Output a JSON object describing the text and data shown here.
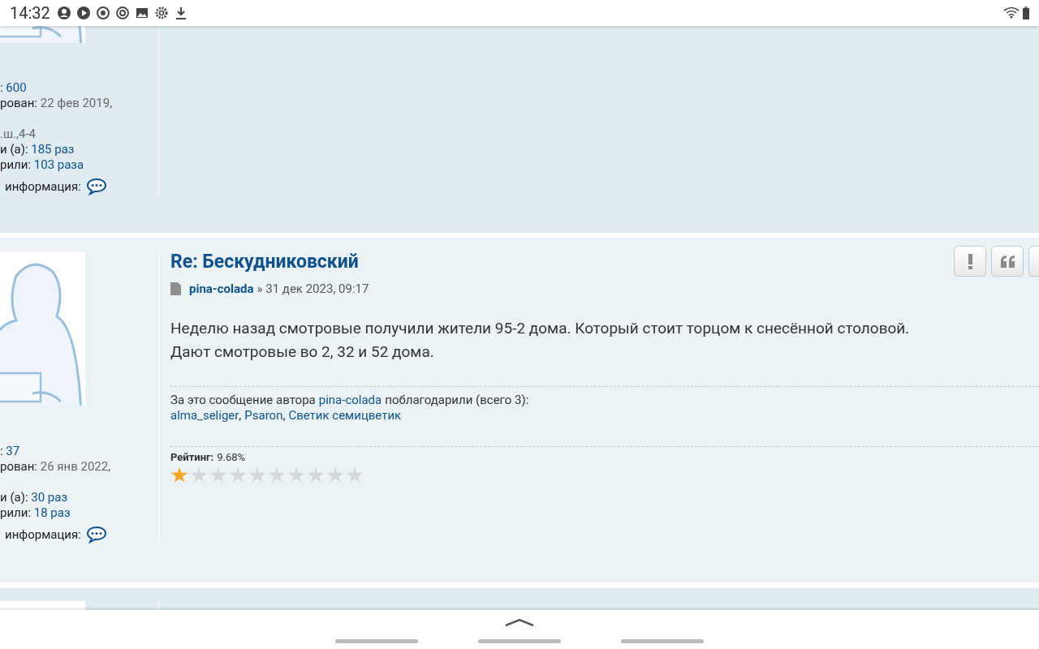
{
  "status_bar": {
    "time": "14:32"
  },
  "posts": [
    {
      "kind": "cut_top",
      "profile": [
        {
          "label": ": ",
          "value": "600",
          "kind": "link"
        },
        {
          "label": "рован: ",
          "value": "22 фев 2019,",
          "kind": "date"
        },
        {
          "value": ".ш.,4-4",
          "kind": "plain"
        },
        {
          "label": "и (а): ",
          "value": "185 раз",
          "kind": "link"
        },
        {
          "label": "рили: ",
          "value": "103 раза",
          "kind": "link"
        },
        {
          "label": "информация:",
          "kind": "contact"
        }
      ]
    },
    {
      "kind": "full",
      "title": "Re: Бескудниковский",
      "author": "pina-colada",
      "sep": "»",
      "date": "31 дек 2023, 09:17",
      "body": [
        "Неделю назад смотровые получили жители 95-2 дома. Который стоит торцом к снесённой столовой.",
        "Дают смотровые во 2, 32 и 52 дома."
      ],
      "thanks": {
        "prefix": "За это сообщение автора",
        "author": "pina-colada",
        "suffix": "поблагодарили (всего 3):",
        "users": [
          {
            "name": "alma_seliger",
            "sep": ","
          },
          {
            "name": "Psaron",
            "sep": ","
          },
          {
            "name": "Светик семицветик"
          }
        ]
      },
      "rating": {
        "label": "Рейтинг:",
        "value": "9.68%",
        "stars": 1
      },
      "buttons": [
        {
          "kind": "report"
        },
        {
          "kind": "quote"
        },
        {
          "kind": "other"
        }
      ],
      "profile": [
        {
          "label": ": ",
          "value": "37",
          "kind": "link"
        },
        {
          "label": "рован: ",
          "value": "26 янв 2022,",
          "kind": "date"
        },
        {
          "label": "и (а): ",
          "value": "30 раз",
          "kind": "link"
        },
        {
          "label": "рили: ",
          "value": "18 раз",
          "kind": "link"
        },
        {
          "label": "информация:",
          "kind": "contact"
        }
      ]
    },
    {
      "kind": "cut_bottom"
    }
  ]
}
